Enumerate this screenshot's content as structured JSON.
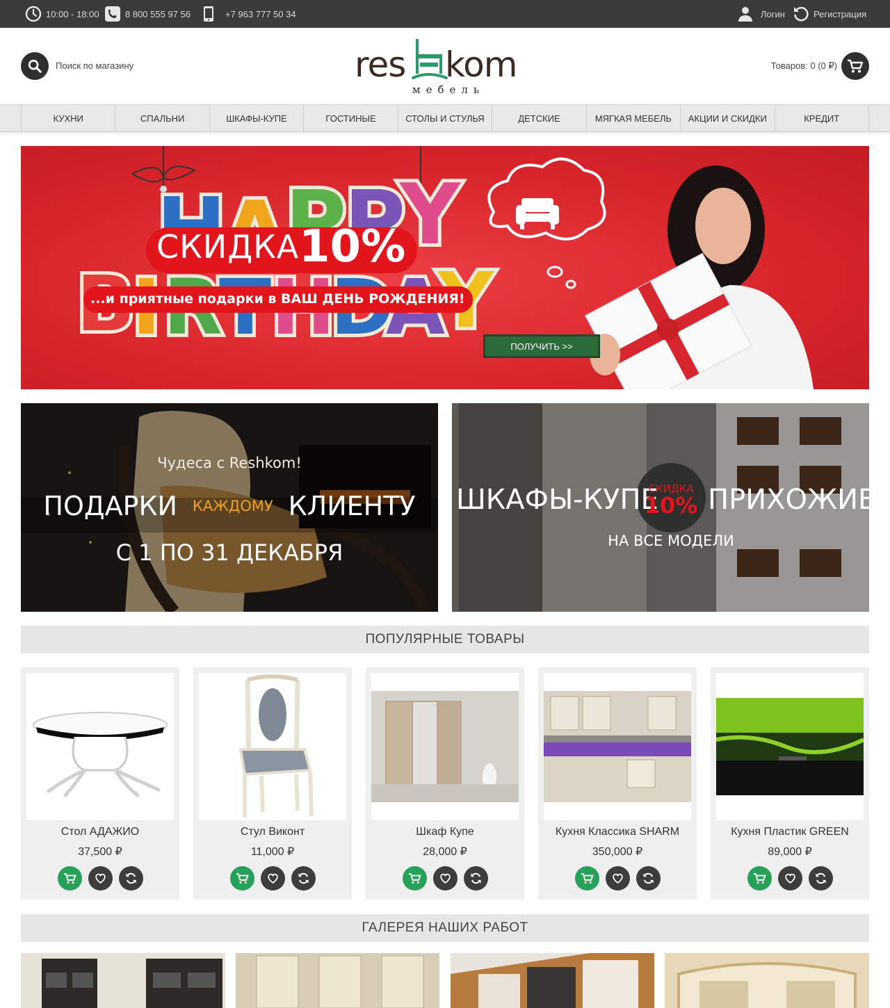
{
  "topbar": {
    "hours": "10:00 - 18:00",
    "phone1": "8 800 555 97 56",
    "phone2": "+7 963 777 50 34",
    "login": "Логин",
    "register": "Регистрация"
  },
  "header": {
    "search_label": "Поиск по магазину",
    "logo_text": "reshkom",
    "logo_sub": "мебель",
    "cart_text": "Товаров: 0 (0 ₽)"
  },
  "nav": [
    "Кухни",
    "Спальни",
    "Шкафы-купе",
    "Гостиные",
    "Столы и стулья",
    "Детские",
    "Мягкая мебель",
    "Акции и скидки",
    "Кредит"
  ],
  "banner": {
    "headline": "HAPPY BIRTHDAY",
    "discount_word": "СКИДКА",
    "discount_value": "10%",
    "subline": "...и приятные подарки в ВАШ ДЕНЬ РОЖДЕНИЯ!",
    "button": "ПОЛУЧИТЬ >>"
  },
  "promo_left": {
    "line1": "Чудеса с Reshkom!",
    "line2a": "ПОДАРКИ",
    "line2b": "КАЖДОМУ",
    "line2c": "КЛИЕНТУ",
    "line3": "С 1 ПО 31 ДЕКАБРЯ"
  },
  "promo_right": {
    "left": "ШКАФЫ-КУПЕ",
    "badge_word": "СКИДКА",
    "badge_value": "10%",
    "right": "ПРИХОЖИЕ",
    "sub": "НА ВСЕ МОДЕЛИ"
  },
  "sections": {
    "popular": "Популярные товары",
    "gallery": "Галерея наших работ"
  },
  "products": [
    {
      "name": "Стол АДАЖИО",
      "price": "37,500 ₽"
    },
    {
      "name": "Стул Виконт",
      "price": "11,000 ₽"
    },
    {
      "name": "Шкаф Купе",
      "price": "28,000 ₽"
    },
    {
      "name": "Кухня Классика SHARM",
      "price": "350,000 ₽"
    },
    {
      "name": "Кухня Пластик GREEN",
      "price": "89,000 ₽"
    }
  ],
  "colors": {
    "topbar": "#3b3b3b",
    "accent_green": "#27a05a",
    "banner_red": "#d8242b",
    "logo_brown": "#3b2a22",
    "logo_green": "#2a9a6a"
  }
}
